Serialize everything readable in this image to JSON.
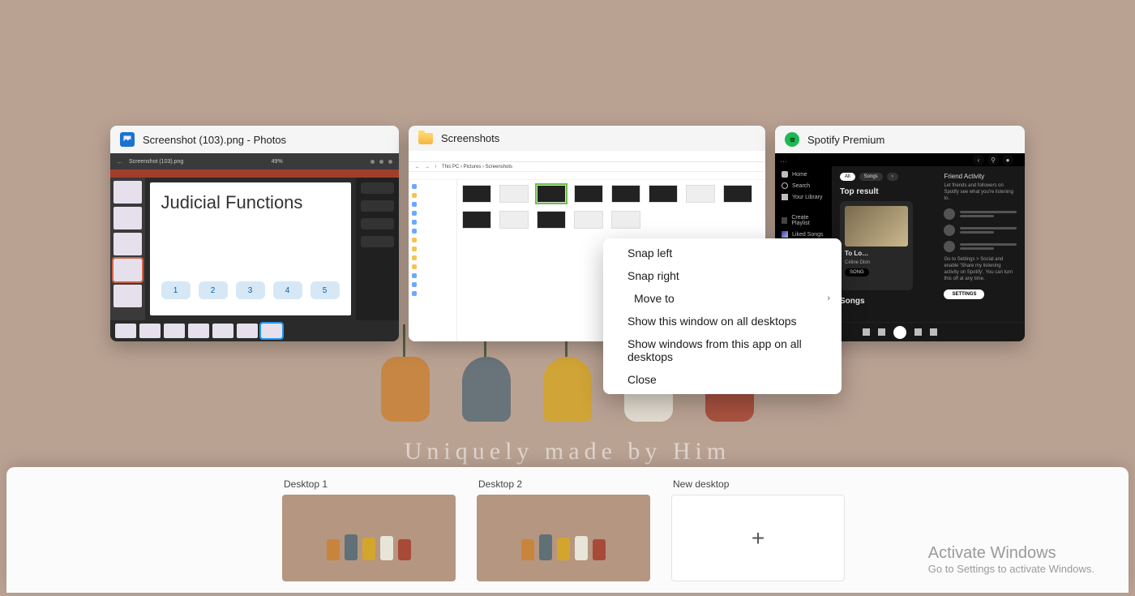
{
  "wallpaper": {
    "caption": "Uniquely made by Him"
  },
  "windows": {
    "photos": {
      "title": "Screenshot (103).png - Photos",
      "content": {
        "filename": "Screenshot (103).png",
        "zoom": "49%",
        "slide_title": "Judicial Functions",
        "pills": [
          "1",
          "2",
          "3",
          "4",
          "5"
        ]
      }
    },
    "explorer": {
      "title": "Screenshots"
    },
    "spotify": {
      "title": "Spotify Premium",
      "content": {
        "sidebar": {
          "items": [
            "Home",
            "Search",
            "Your Library",
            "Create Playlist",
            "Liked Songs"
          ]
        },
        "chips": [
          "All",
          "Songs"
        ],
        "top_result_label": "Top result",
        "track_name": "To Lo…",
        "track_artist": "Céline Dion",
        "track_kind": "SONG",
        "songs_section": "Songs",
        "friends": {
          "header": "Friend Activity",
          "text": "Let friends and followers on Spotify see what you're listening to.",
          "hint": "Go to Settings > Social and enable 'Share my listening activity on Spotify'. You can turn this off at any time.",
          "settings_btn": "SETTINGS"
        }
      }
    }
  },
  "context_menu": {
    "items": [
      {
        "label": "Snap left",
        "has_submenu": false
      },
      {
        "label": "Snap right",
        "has_submenu": false
      },
      {
        "label": "Move to",
        "has_submenu": true
      },
      {
        "label": "Show this window on all desktops",
        "has_submenu": false
      },
      {
        "label": "Show windows from this app on all desktops",
        "has_submenu": false
      },
      {
        "label": "Close",
        "has_submenu": false
      }
    ]
  },
  "desktops": {
    "items": [
      {
        "label": "Desktop 1",
        "active": true
      },
      {
        "label": "Desktop 2",
        "active": false
      }
    ],
    "new_label": "New desktop"
  },
  "watermark": {
    "line1": "Activate Windows",
    "line2": "Go to Settings to activate Windows."
  }
}
